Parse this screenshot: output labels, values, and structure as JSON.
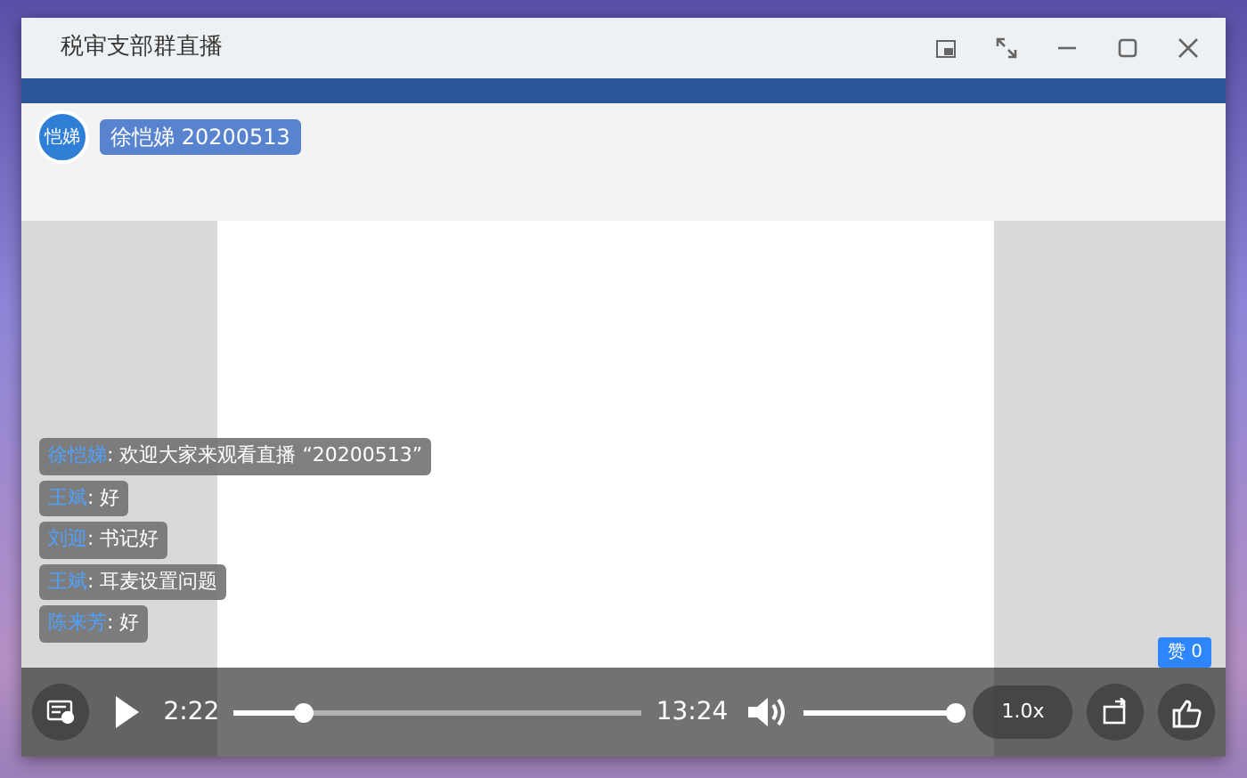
{
  "window": {
    "title": "税审支部群直播"
  },
  "host": {
    "avatar_text": "恺娣",
    "name": "徐恺娣 20200513"
  },
  "chat": [
    {
      "user": "徐恺娣",
      "message": ": 欢迎大家来观看直播 “20200513”"
    },
    {
      "user": "王斌",
      "message": ": 好"
    },
    {
      "user": "刘迎",
      "message": ": 书记好"
    },
    {
      "user": "王斌",
      "message": ": 耳麦设置问题"
    },
    {
      "user": "陈来芳",
      "message": ": 好"
    }
  ],
  "likes": {
    "label": "赞 0"
  },
  "player": {
    "playing": false,
    "elapsed": "2:22",
    "duration": "13:24",
    "progress": {
      "level": 0.17
    },
    "volume": {
      "level": 0.97
    },
    "speed": "1.0x"
  }
}
